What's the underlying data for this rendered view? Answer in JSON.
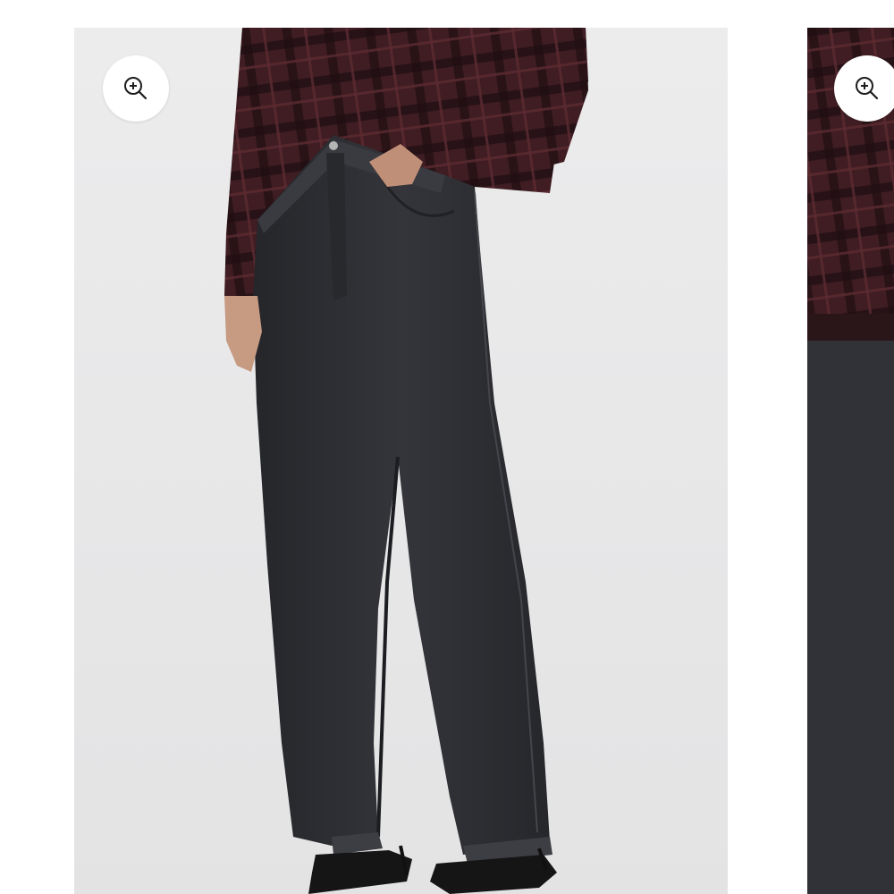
{
  "gallery": {
    "slides": [
      {
        "subject": "product-photo-wide-leg-black-jeans-front",
        "zoom_icon": "zoom-in-icon"
      },
      {
        "subject": "product-photo-wide-leg-black-jeans-detail",
        "zoom_icon": "zoom-in-icon"
      }
    ]
  },
  "colors": {
    "page_background": "#ffffff",
    "photo_background": "#e9e9ea",
    "denim": "#2f3033",
    "plaid_shirt": "#3f1d22",
    "shoe": "#1a1a1a",
    "zoom_button": "#ffffff",
    "icon": "#1c1c1c"
  }
}
